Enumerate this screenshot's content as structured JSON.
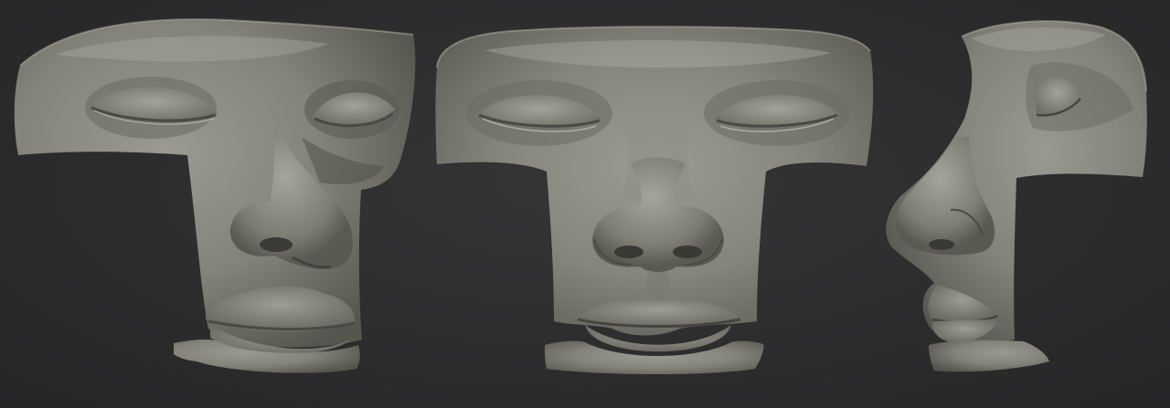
{
  "scene": {
    "background_color": "#2d2d2e",
    "material_color": "#8d8d83",
    "views": [
      {
        "view": "three-quarter",
        "features": [
          "forehead",
          "left-eye",
          "right-eye",
          "nose",
          "upper-lip",
          "lower-lip"
        ]
      },
      {
        "view": "front",
        "features": [
          "forehead",
          "left-eye",
          "right-eye",
          "nose",
          "upper-lip",
          "lower-lip"
        ]
      },
      {
        "view": "profile",
        "features": [
          "forehead",
          "eye",
          "nose",
          "upper-lip",
          "lower-lip"
        ]
      }
    ]
  }
}
